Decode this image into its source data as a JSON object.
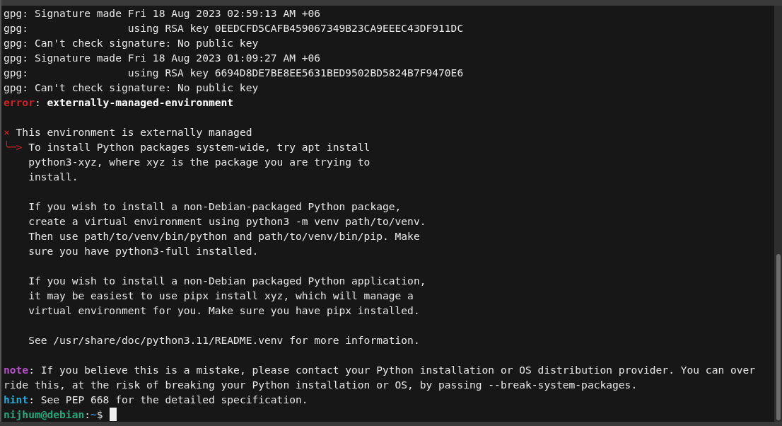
{
  "terminal": {
    "lines": [
      {
        "kind": "text",
        "spans": [
          {
            "kind": "plain",
            "text": "gpg: Signature made Fri 18 Aug 2023 02:59:13 AM +06"
          }
        ]
      },
      {
        "kind": "text",
        "spans": [
          {
            "kind": "plain",
            "text": "gpg:                using RSA key 0EEDCFD5CAFB459067349B23CA9EEEC43DF911DC"
          }
        ]
      },
      {
        "kind": "text",
        "spans": [
          {
            "kind": "plain",
            "text": "gpg: Can't check signature: No public key"
          }
        ]
      },
      {
        "kind": "text",
        "spans": [
          {
            "kind": "plain",
            "text": "gpg: Signature made Fri 18 Aug 2023 01:09:27 AM +06"
          }
        ]
      },
      {
        "kind": "text",
        "spans": [
          {
            "kind": "plain",
            "text": "gpg:                using RSA key 6694D8DE7BE8EE5631BED9502BD5824B7F9470E6"
          }
        ]
      },
      {
        "kind": "text",
        "spans": [
          {
            "kind": "plain",
            "text": "gpg: Can't check signature: No public key"
          }
        ]
      },
      {
        "kind": "text",
        "spans": [
          {
            "kind": "error",
            "text": "error"
          },
          {
            "kind": "plain",
            "text": ": "
          },
          {
            "kind": "bold",
            "text": "externally-managed-environment"
          }
        ]
      },
      {
        "kind": "blank"
      },
      {
        "kind": "text",
        "spans": [
          {
            "kind": "mark",
            "text": "×"
          },
          {
            "kind": "plain",
            "text": " This environment is externally managed"
          }
        ]
      },
      {
        "kind": "text",
        "spans": [
          {
            "kind": "mark",
            "text": "╰─>"
          },
          {
            "kind": "plain",
            "text": " To install Python packages system-wide, try apt install"
          }
        ]
      },
      {
        "kind": "text",
        "spans": [
          {
            "kind": "plain",
            "text": "    python3-xyz, where xyz is the package you are trying to"
          }
        ]
      },
      {
        "kind": "text",
        "spans": [
          {
            "kind": "plain",
            "text": "    install."
          }
        ]
      },
      {
        "kind": "blank"
      },
      {
        "kind": "text",
        "spans": [
          {
            "kind": "plain",
            "text": "    If you wish to install a non-Debian-packaged Python package,"
          }
        ]
      },
      {
        "kind": "text",
        "spans": [
          {
            "kind": "plain",
            "text": "    create a virtual environment using python3 -m venv path/to/venv."
          }
        ]
      },
      {
        "kind": "text",
        "spans": [
          {
            "kind": "plain",
            "text": "    Then use path/to/venv/bin/python and path/to/venv/bin/pip. Make"
          }
        ]
      },
      {
        "kind": "text",
        "spans": [
          {
            "kind": "plain",
            "text": "    sure you have python3-full installed."
          }
        ]
      },
      {
        "kind": "blank"
      },
      {
        "kind": "text",
        "spans": [
          {
            "kind": "plain",
            "text": "    If you wish to install a non-Debian packaged Python application,"
          }
        ]
      },
      {
        "kind": "text",
        "spans": [
          {
            "kind": "plain",
            "text": "    it may be easiest to use pipx install xyz, which will manage a"
          }
        ]
      },
      {
        "kind": "text",
        "spans": [
          {
            "kind": "plain",
            "text": "    virtual environment for you. Make sure you have pipx installed."
          }
        ]
      },
      {
        "kind": "blank"
      },
      {
        "kind": "text",
        "spans": [
          {
            "kind": "plain",
            "text": "    See /usr/share/doc/python3.11/README.venv for more information."
          }
        ]
      },
      {
        "kind": "blank"
      },
      {
        "kind": "text",
        "spans": [
          {
            "kind": "note",
            "text": "note"
          },
          {
            "kind": "plain",
            "text": ": If you believe this is a mistake, please contact your Python installation or OS distribution provider. You can over"
          }
        ]
      },
      {
        "kind": "text",
        "spans": [
          {
            "kind": "plain",
            "text": "ride this, at the risk of breaking your Python installation or OS, by passing --break-system-packages."
          }
        ]
      },
      {
        "kind": "text",
        "spans": [
          {
            "kind": "hint",
            "text": "hint"
          },
          {
            "kind": "plain",
            "text": ": See PEP 668 for the detailed specification."
          }
        ]
      },
      {
        "kind": "prompt",
        "spans": [
          {
            "kind": "user",
            "text": "nijhum@debian"
          },
          {
            "kind": "plain",
            "text": ":"
          },
          {
            "kind": "path",
            "text": "~"
          },
          {
            "kind": "plain",
            "text": "$ "
          }
        ]
      }
    ]
  }
}
